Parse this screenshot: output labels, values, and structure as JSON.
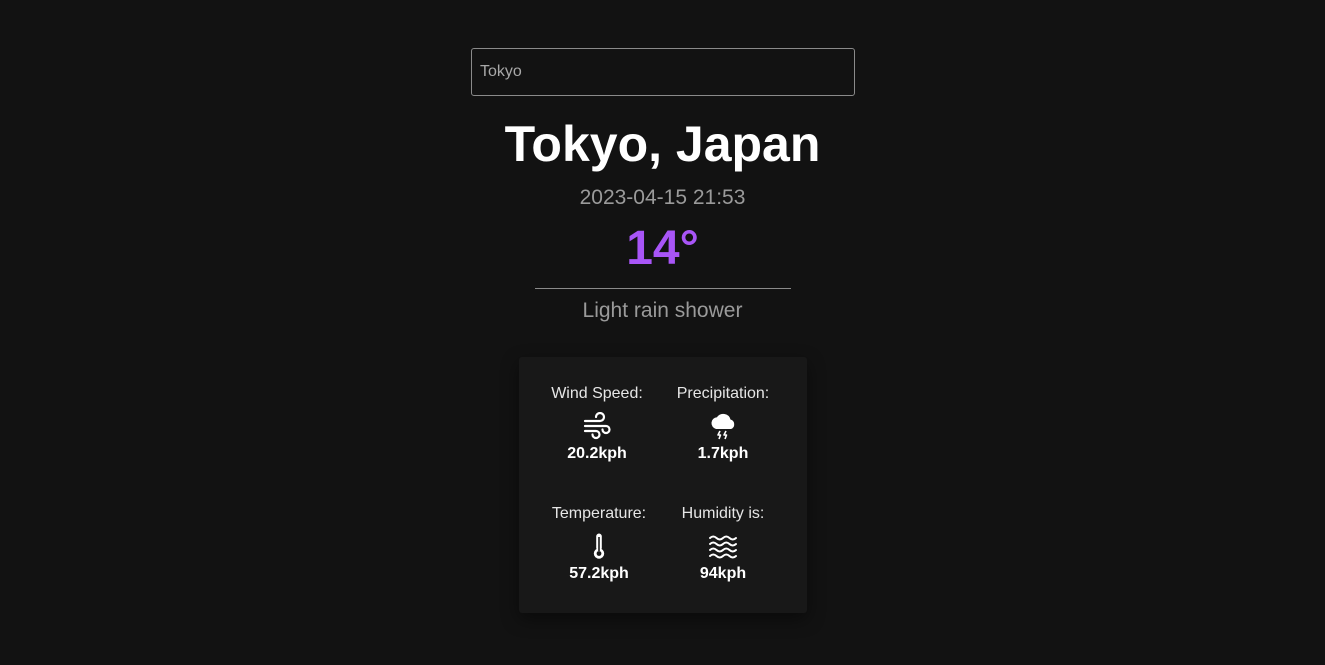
{
  "search": {
    "value": "Tokyo",
    "placeholder": ""
  },
  "location": {
    "title": "Tokyo, Japan",
    "datetime": "2023-04-15 21:53"
  },
  "current": {
    "temperature": "14°",
    "condition": "Light rain shower"
  },
  "stats": [
    {
      "label": "Wind Speed:",
      "icon": "wind-icon",
      "value": "20.2kph"
    },
    {
      "label": "Precipitation:",
      "icon": "cloud-lightning-icon",
      "value": "1.7kph"
    },
    {
      "label": "Temperature:",
      "icon": "thermometer-icon",
      "value": "57.2kph"
    },
    {
      "label": "Humidity is:",
      "icon": "water-waves-icon",
      "value": "94kph"
    }
  ],
  "colors": {
    "background": "#121212",
    "accent": "#a855f7",
    "card": "#181818",
    "muted_text": "#9a9a9a"
  }
}
